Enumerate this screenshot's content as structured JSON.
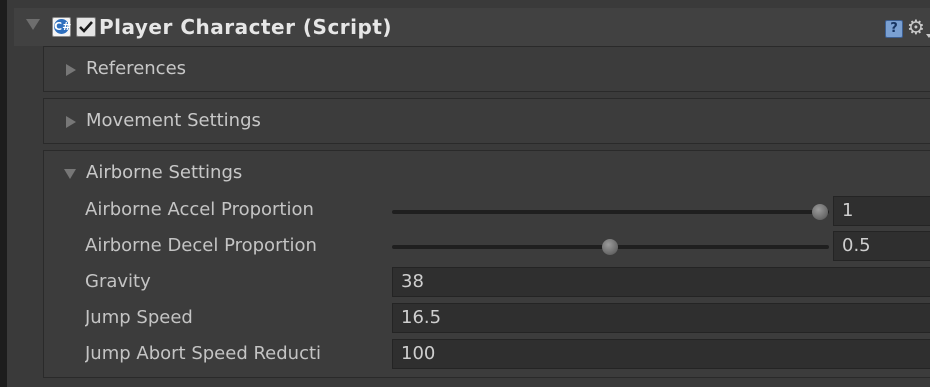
{
  "component": {
    "title": "Player Character (Script)",
    "script_icon": "C#",
    "enabled": true
  },
  "sections": [
    {
      "label": "References",
      "expanded": false
    },
    {
      "label": "Movement Settings",
      "expanded": false
    },
    {
      "label": "Airborne Settings",
      "expanded": true
    }
  ],
  "airborne": {
    "accel_label": "Airborne Accel Proportion",
    "accel_value": "1",
    "accel_fraction": 1.0,
    "decel_label": "Airborne Decel Proportion",
    "decel_value": "0.5",
    "decel_fraction": 0.5,
    "gravity_label": "Gravity",
    "gravity_value": "38",
    "jump_speed_label": "Jump Speed",
    "jump_speed_value": "16.5",
    "jump_abort_label": "Jump Abort Speed Reducti",
    "jump_abort_value": "100"
  },
  "icons": {
    "help": "help-icon",
    "gear": "gear-icon"
  },
  "colors": {
    "panel_bg": "#3a3a3a",
    "text": "#c4c4c4",
    "field_bg": "#2f2f2f"
  }
}
